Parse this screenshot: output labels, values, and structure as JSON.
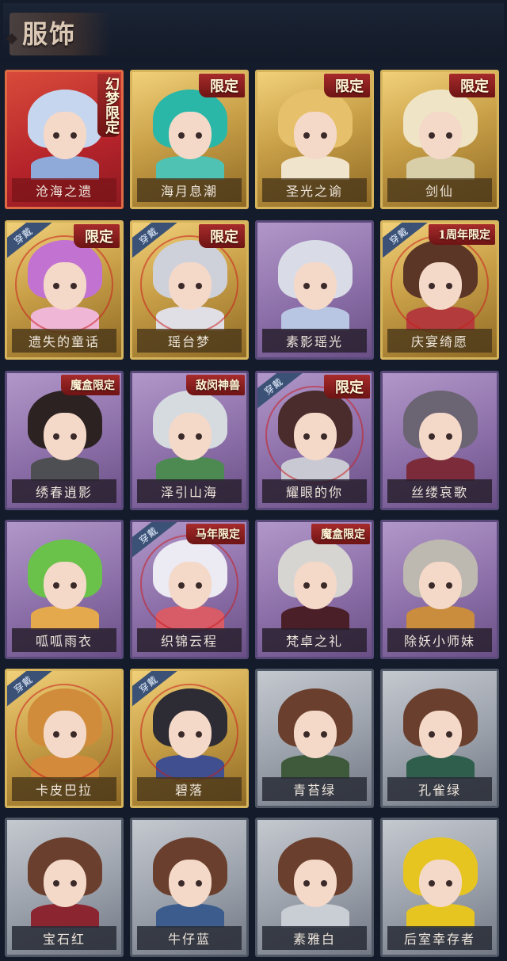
{
  "header": {
    "title": "服饰"
  },
  "labels": {
    "equipped": "穿戴"
  },
  "colors": {
    "background": "#141c2c",
    "frame_red": "#c93630",
    "frame_gold": "#c9a048",
    "frame_purple": "#8c6fa8",
    "frame_gray": "#9aa0aa",
    "tag_red": "#8e2020"
  },
  "costumes": [
    {
      "name": "沧海之遗",
      "frame": "red",
      "tag": "幻梦限定",
      "equipped": false,
      "hair": "#c6d6ef",
      "outfit": "#8fa9d8"
    },
    {
      "name": "海月息潮",
      "frame": "gold",
      "tag": "限定",
      "equipped": false,
      "hair": "#2ab7a8",
      "outfit": "#4fc2b3"
    },
    {
      "name": "圣光之谕",
      "frame": "gold",
      "tag": "限定",
      "equipped": false,
      "hair": "#e7c06b",
      "outfit": "#f0e4cc"
    },
    {
      "name": "剑仙",
      "frame": "gold",
      "tag": "限定",
      "equipped": false,
      "hair": "#efe5c6",
      "outfit": "#d8cfa9"
    },
    {
      "name": "遗失的童话",
      "frame": "gold",
      "tag": "限定",
      "equipped": true,
      "hair": "#c273d1",
      "outfit": "#f0b6d6"
    },
    {
      "name": "瑶台梦",
      "frame": "gold",
      "tag": "限定",
      "equipped": true,
      "hair": "#cfd1da",
      "outfit": "#e1dfe6"
    },
    {
      "name": "素影瑶光",
      "frame": "purple",
      "tag": "",
      "equipped": false,
      "hair": "#d9dce6",
      "outfit": "#b8c6e4"
    },
    {
      "name": "庆宴绮愿",
      "frame": "gold",
      "tag": "1周年限定",
      "equipped": true,
      "hair": "#5b3526",
      "outfit": "#b33b3b"
    },
    {
      "name": "绣春逍影",
      "frame": "purple",
      "tag": "魔盒限定",
      "equipped": false,
      "hair": "#2b2221",
      "outfit": "#4e4f52"
    },
    {
      "name": "泽引山海",
      "frame": "purple",
      "tag": "敌闵神兽",
      "equipped": false,
      "hair": "#d6dbe0",
      "outfit": "#4d8a52"
    },
    {
      "name": "耀眼的你",
      "frame": "purple",
      "tag": "限定",
      "equipped": true,
      "hair": "#4a2c2c",
      "outfit": "#c9c9d3"
    },
    {
      "name": "丝缕哀歌",
      "frame": "purple",
      "tag": "",
      "equipped": false,
      "hair": "#6b6473",
      "outfit": "#7b2b3a"
    },
    {
      "name": "呱呱雨衣",
      "frame": "purple",
      "tag": "",
      "equipped": false,
      "hair": "#6ac24b",
      "outfit": "#e4a94d"
    },
    {
      "name": "织锦云程",
      "frame": "purple",
      "tag": "马年限定",
      "equipped": true,
      "hair": "#eceaf2",
      "outfit": "#d85b68"
    },
    {
      "name": "梵卓之礼",
      "frame": "purple",
      "tag": "魔盒限定",
      "equipped": false,
      "hair": "#d6d5d2",
      "outfit": "#4b1f28"
    },
    {
      "name": "除妖小师妹",
      "frame": "purple",
      "tag": "",
      "equipped": false,
      "hair": "#bdb8b0",
      "outfit": "#c98d3d"
    },
    {
      "name": "卡皮巴拉",
      "frame": "gold",
      "tag": "",
      "equipped": true,
      "hair": "#d08c3b",
      "outfit": "#d38a3a"
    },
    {
      "name": "碧落",
      "frame": "gold",
      "tag": "",
      "equipped": true,
      "hair": "#2d2b33",
      "outfit": "#3f4f8f"
    },
    {
      "name": "青苔绿",
      "frame": "gray",
      "tag": "",
      "equipped": false,
      "hair": "#6b3f2d",
      "outfit": "#3e5a3a"
    },
    {
      "name": "孔雀绿",
      "frame": "gray",
      "tag": "",
      "equipped": false,
      "hair": "#6b3f2d",
      "outfit": "#2f5f4c"
    },
    {
      "name": "宝石红",
      "frame": "gray",
      "tag": "",
      "equipped": false,
      "hair": "#6b3f2d",
      "outfit": "#8b2530"
    },
    {
      "name": "牛仔蓝",
      "frame": "gray",
      "tag": "",
      "equipped": false,
      "hair": "#6b3f2d",
      "outfit": "#3b5c8c"
    },
    {
      "name": "素雅白",
      "frame": "gray",
      "tag": "",
      "equipped": false,
      "hair": "#6b3f2d",
      "outfit": "#c9ced4"
    },
    {
      "name": "后室幸存者",
      "frame": "gray",
      "tag": "",
      "equipped": false,
      "hair": "#e7c520",
      "outfit": "#e7c520"
    }
  ]
}
